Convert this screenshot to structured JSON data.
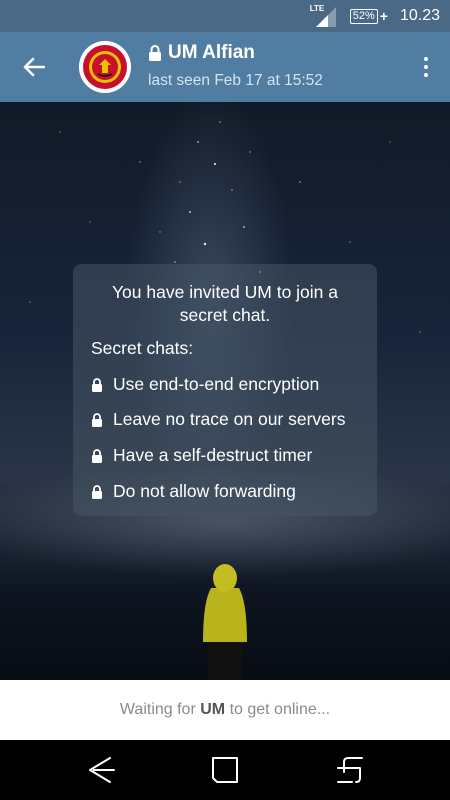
{
  "status_bar": {
    "network": "LTE",
    "battery": "52%",
    "battery_charging": "+",
    "time": "10.23"
  },
  "header": {
    "back_icon": "arrow-left-icon",
    "avatar_alt": "Manchester United crest",
    "title": "UM Alfian",
    "last_seen": "last seen Feb 17 at 15:52",
    "menu_icon": "more-vertical-icon"
  },
  "info_bubble": {
    "invite_line1": "You have invited UM to join a",
    "invite_line2": "secret chat.",
    "heading": "Secret chats:",
    "features": [
      "Use end-to-end encryption",
      "Leave no trace on our servers",
      "Have a self-destruct timer",
      "Do not allow forwarding"
    ]
  },
  "footer": {
    "waiting_prefix": "Waiting for ",
    "waiting_name": "UM",
    "waiting_suffix": " to get online..."
  },
  "nav": {
    "back": "nav-back-icon",
    "home": "nav-home-icon",
    "recents": "nav-recents-icon"
  },
  "colors": {
    "status_bar": "#4a6986",
    "header": "#517da2",
    "nav_bar": "#000000"
  }
}
